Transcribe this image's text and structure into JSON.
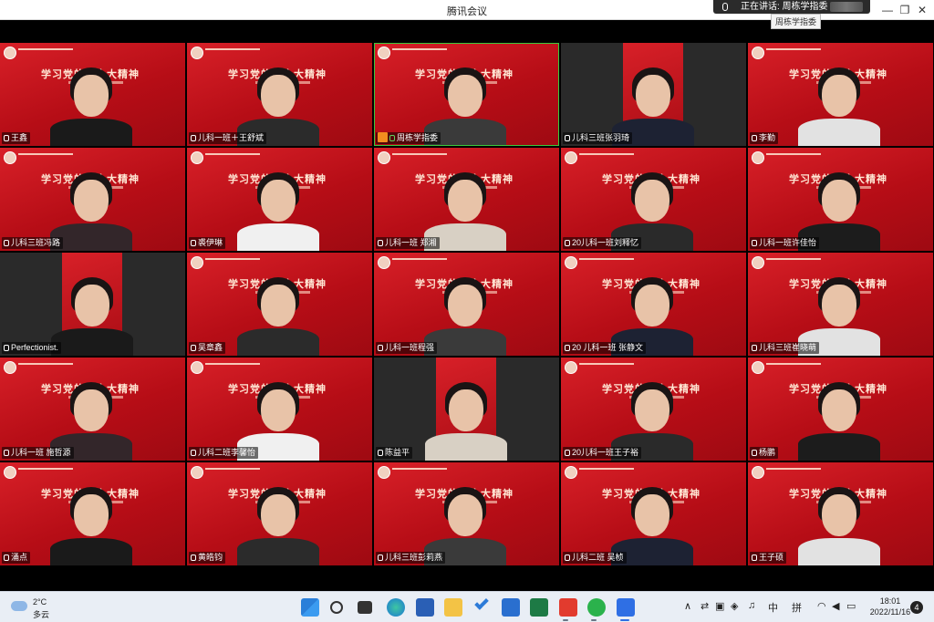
{
  "window": {
    "title": "腾讯会议",
    "speaking_label": "正在讲话: 周栋学指委",
    "tooltip": "周栋学指委",
    "minimize": "—",
    "restore": "❐",
    "close": "✕"
  },
  "banner_text": "学习党的二十大精神",
  "participants": [
    {
      "name": "王鑫"
    },
    {
      "name": "儿科一班＋王舒斌"
    },
    {
      "name": "周栋学指委"
    },
    {
      "name": "儿科三班张羽琦"
    },
    {
      "name": "李勤"
    },
    {
      "name": "儿科三班冯路"
    },
    {
      "name": "裘伊琳"
    },
    {
      "name": "儿科一班 郑湘"
    },
    {
      "name": "20儿科一班刘释忆"
    },
    {
      "name": "儿科一班许佳怡"
    },
    {
      "name": "Perfectionist."
    },
    {
      "name": "吴章鑫"
    },
    {
      "name": "儿科一班程强"
    },
    {
      "name": "20 儿科一班 张静文"
    },
    {
      "name": "儿科三班崔晓萌"
    },
    {
      "name": "儿科一班 施哲源"
    },
    {
      "name": "儿科二班李馨怡"
    },
    {
      "name": "陈益平"
    },
    {
      "name": "20儿科一班王子裕"
    },
    {
      "name": "杨鹏"
    },
    {
      "name": "涌点"
    },
    {
      "name": "黄皓钧"
    },
    {
      "name": "儿科三班彭莉燕"
    },
    {
      "name": "儿科二班 吴桢"
    },
    {
      "name": "王子硕"
    }
  ],
  "taskbar": {
    "weather_temp": "2°C",
    "weather_cond": "多云",
    "ime_mode": "中",
    "ime_layout": "拼",
    "time": "18:01",
    "date": "2022/11/16",
    "notifications": "4"
  },
  "colors": {
    "banner_red": "#c1121b",
    "active_speaker": "#3cc83c",
    "taskbar_bg": "#e9eef5"
  }
}
